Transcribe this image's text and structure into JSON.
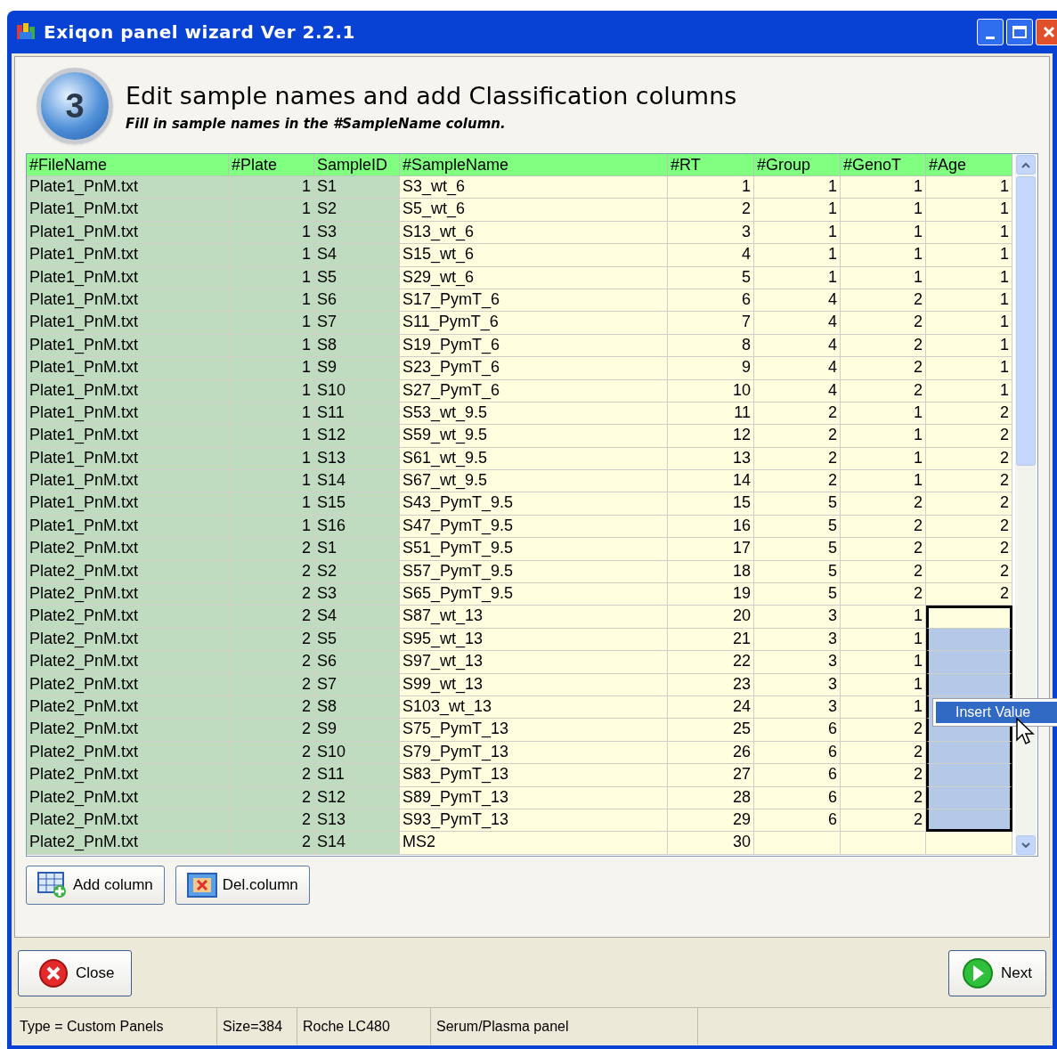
{
  "window": {
    "title": "Exiqon panel wizard Ver 2.2.1"
  },
  "header": {
    "step": "3",
    "title": "Edit sample names and add Classification columns",
    "subtitle": "Fill in sample names in the #SampleName column."
  },
  "table": {
    "columns": [
      {
        "label": "#FileName",
        "kind": "text",
        "editable": false
      },
      {
        "label": "#Plate",
        "kind": "number",
        "editable": false
      },
      {
        "label": "SampleID",
        "kind": "text",
        "editable": false
      },
      {
        "label": "#SampleName",
        "kind": "text",
        "editable": true
      },
      {
        "label": "#RT",
        "kind": "number",
        "editable": true
      },
      {
        "label": "#Group",
        "kind": "number",
        "editable": true
      },
      {
        "label": "#GenoT",
        "kind": "number",
        "editable": true
      },
      {
        "label": "#Age",
        "kind": "number",
        "editable": true
      }
    ],
    "rows": [
      {
        "cells": [
          "Plate1_PnM.txt",
          "1",
          "S1",
          "S3_wt_6",
          "1",
          "1",
          "1",
          "1"
        ],
        "selected": false
      },
      {
        "cells": [
          "Plate1_PnM.txt",
          "1",
          "S2",
          "S5_wt_6",
          "2",
          "1",
          "1",
          "1"
        ],
        "selected": false
      },
      {
        "cells": [
          "Plate1_PnM.txt",
          "1",
          "S3",
          "S13_wt_6",
          "3",
          "1",
          "1",
          "1"
        ],
        "selected": false
      },
      {
        "cells": [
          "Plate1_PnM.txt",
          "1",
          "S4",
          "S15_wt_6",
          "4",
          "1",
          "1",
          "1"
        ],
        "selected": false
      },
      {
        "cells": [
          "Plate1_PnM.txt",
          "1",
          "S5",
          "S29_wt_6",
          "5",
          "1",
          "1",
          "1"
        ],
        "selected": false
      },
      {
        "cells": [
          "Plate1_PnM.txt",
          "1",
          "S6",
          "S17_PymT_6",
          "6",
          "4",
          "2",
          "1"
        ],
        "selected": false
      },
      {
        "cells": [
          "Plate1_PnM.txt",
          "1",
          "S7",
          "S11_PymT_6",
          "7",
          "4",
          "2",
          "1"
        ],
        "selected": false
      },
      {
        "cells": [
          "Plate1_PnM.txt",
          "1",
          "S8",
          "S19_PymT_6",
          "8",
          "4",
          "2",
          "1"
        ],
        "selected": false
      },
      {
        "cells": [
          "Plate1_PnM.txt",
          "1",
          "S9",
          "S23_PymT_6",
          "9",
          "4",
          "2",
          "1"
        ],
        "selected": false
      },
      {
        "cells": [
          "Plate1_PnM.txt",
          "1",
          "S10",
          "S27_PymT_6",
          "10",
          "4",
          "2",
          "1"
        ],
        "selected": false
      },
      {
        "cells": [
          "Plate1_PnM.txt",
          "1",
          "S11",
          "S53_wt_9.5",
          "11",
          "2",
          "1",
          "2"
        ],
        "selected": false
      },
      {
        "cells": [
          "Plate1_PnM.txt",
          "1",
          "S12",
          "S59_wt_9.5",
          "12",
          "2",
          "1",
          "2"
        ],
        "selected": false
      },
      {
        "cells": [
          "Plate1_PnM.txt",
          "1",
          "S13",
          "S61_wt_9.5",
          "13",
          "2",
          "1",
          "2"
        ],
        "selected": false
      },
      {
        "cells": [
          "Plate1_PnM.txt",
          "1",
          "S14",
          "S67_wt_9.5",
          "14",
          "2",
          "1",
          "2"
        ],
        "selected": false
      },
      {
        "cells": [
          "Plate1_PnM.txt",
          "1",
          "S15",
          "S43_PymT_9.5",
          "15",
          "5",
          "2",
          "2"
        ],
        "selected": false
      },
      {
        "cells": [
          "Plate1_PnM.txt",
          "1",
          "S16",
          "S47_PymT_9.5",
          "16",
          "5",
          "2",
          "2"
        ],
        "selected": false
      },
      {
        "cells": [
          "Plate2_PnM.txt",
          "2",
          "S1",
          "S51_PymT_9.5",
          "17",
          "5",
          "2",
          "2"
        ],
        "selected": false
      },
      {
        "cells": [
          "Plate2_PnM.txt",
          "2",
          "S2",
          "S57_PymT_9.5",
          "18",
          "5",
          "2",
          "2"
        ],
        "selected": false
      },
      {
        "cells": [
          "Plate2_PnM.txt",
          "2",
          "S3",
          "S65_PymT_9.5",
          "19",
          "5",
          "2",
          "2"
        ],
        "selected": false
      },
      {
        "cells": [
          "Plate2_PnM.txt",
          "2",
          "S4",
          "S87_wt_13",
          "20",
          "3",
          "1"
        ],
        "selected": true
      },
      {
        "cells": [
          "Plate2_PnM.txt",
          "2",
          "S5",
          "S95_wt_13",
          "21",
          "3",
          "1"
        ],
        "selected": true
      },
      {
        "cells": [
          "Plate2_PnM.txt",
          "2",
          "S6",
          "S97_wt_13",
          "22",
          "3",
          "1"
        ],
        "selected": true
      },
      {
        "cells": [
          "Plate2_PnM.txt",
          "2",
          "S7",
          "S99_wt_13",
          "23",
          "3",
          "1"
        ],
        "selected": true
      },
      {
        "cells": [
          "Plate2_PnM.txt",
          "2",
          "S8",
          "S103_wt_13",
          "24",
          "3",
          "1"
        ],
        "selected": true
      },
      {
        "cells": [
          "Plate2_PnM.txt",
          "2",
          "S9",
          "S75_PymT_13",
          "25",
          "6",
          "2"
        ],
        "selected": true
      },
      {
        "cells": [
          "Plate2_PnM.txt",
          "2",
          "S10",
          "S79_PymT_13",
          "26",
          "6",
          "2"
        ],
        "selected": true
      },
      {
        "cells": [
          "Plate2_PnM.txt",
          "2",
          "S11",
          "S83_PymT_13",
          "27",
          "6",
          "2"
        ],
        "selected": true
      },
      {
        "cells": [
          "Plate2_PnM.txt",
          "2",
          "S12",
          "S89_PymT_13",
          "28",
          "6",
          "2"
        ],
        "selected": true
      },
      {
        "cells": [
          "Plate2_PnM.txt",
          "2",
          "S13",
          "S93_PymT_13",
          "29",
          "6",
          "2"
        ],
        "selected": true
      },
      {
        "cells": [
          "Plate2_PnM.txt",
          "2",
          "S14",
          "MS2",
          "30"
        ],
        "selected": false
      }
    ]
  },
  "context_menu": {
    "items": [
      {
        "label": "Insert Value",
        "selected": true
      }
    ]
  },
  "table_buttons": [
    {
      "label": "Add column",
      "kind": "add"
    },
    {
      "label": "Del.column",
      "kind": "delete"
    }
  ],
  "footer_buttons": [
    {
      "label": "Close",
      "kind": "close"
    },
    {
      "label": "Next",
      "kind": "next"
    }
  ],
  "status_bar": [
    "Type = Custom Panels",
    "Size=384",
    "Roche LC480",
    "Serum/Plasma panel"
  ]
}
